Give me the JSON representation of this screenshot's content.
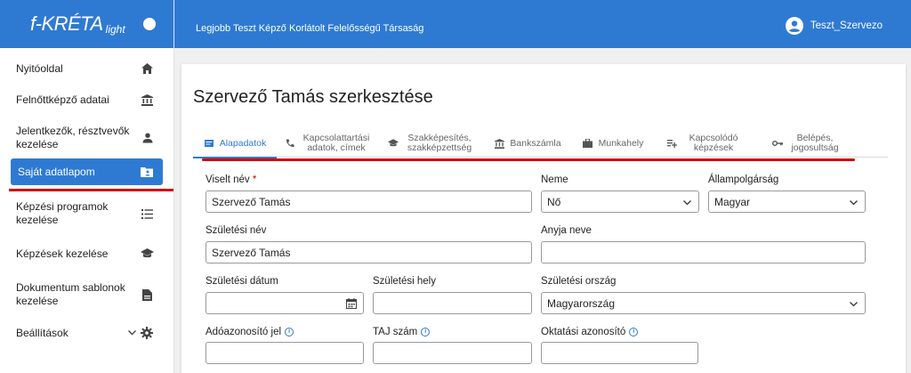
{
  "brand": {
    "logo": "f-KRÉTA",
    "logo_sub": "light"
  },
  "header": {
    "organization": "Legjobb Teszt Képző Korlátolt Felelősségű Társaság",
    "user": "Teszt_Szervezo"
  },
  "sidebar": {
    "items": [
      {
        "label": "Nyitóoldal",
        "icon": "home-icon"
      },
      {
        "label": "Felnőttképző adatai",
        "icon": "bank-icon"
      },
      {
        "label": "Jelentkezők, résztvevők kezelése",
        "icon": "person-icon"
      },
      {
        "label": "Saját adatlapom",
        "icon": "account-box-icon",
        "active": true
      },
      {
        "label": "Képzési programok kezelése",
        "icon": "list-icon"
      },
      {
        "label": "Képzések kezelése",
        "icon": "graduation-cap-icon"
      },
      {
        "label": "Dokumentum sablonok kezelése",
        "icon": "document-icon"
      },
      {
        "label": "Beállítások",
        "icon": "gear-icon"
      }
    ]
  },
  "main": {
    "title": "Szervező Tamás szerkesztése",
    "tabs": [
      {
        "label": "Alapadatok",
        "icon": "card-icon",
        "active": true
      },
      {
        "label": "Kapcsolattartási adatok, címek",
        "icon": "phone-icon"
      },
      {
        "label": "Szakképesítés, szakképzettség",
        "icon": "graduation-cap-icon"
      },
      {
        "label": "Bankszámla",
        "icon": "bank-icon"
      },
      {
        "label": "Munkahely",
        "icon": "briefcase-icon"
      },
      {
        "label": "Kapcsolódó képzések",
        "icon": "playlist-add-icon"
      },
      {
        "label": "Belépés, jogosultság",
        "icon": "key-icon"
      }
    ],
    "form": {
      "viselt_nev": {
        "label": "Viselt név",
        "required": "*",
        "value": "Szervező Tamás"
      },
      "neme": {
        "label": "Neme",
        "value": "Nő"
      },
      "allampolgarsag": {
        "label": "Állampolgárság",
        "value": "Magyar"
      },
      "szuletesi_nev": {
        "label": "Születési név",
        "value": "Szervező Tamás"
      },
      "anyja_neve": {
        "label": "Anyja neve",
        "value": ""
      },
      "szuletesi_datum": {
        "label": "Születési dátum",
        "value": ""
      },
      "szuletesi_hely": {
        "label": "Születési hely",
        "value": ""
      },
      "szuletesi_orszag": {
        "label": "Születési ország",
        "value": "Magyarország"
      },
      "adoazonosito": {
        "label": "Adóazonosító jel",
        "value": ""
      },
      "taj": {
        "label": "TAJ szám",
        "value": ""
      },
      "oktatasi_azonosito": {
        "label": "Oktatási azonosító",
        "value": ""
      }
    }
  },
  "colors": {
    "brand_blue": "#2e7ad3",
    "annotation_red": "#d40000"
  }
}
